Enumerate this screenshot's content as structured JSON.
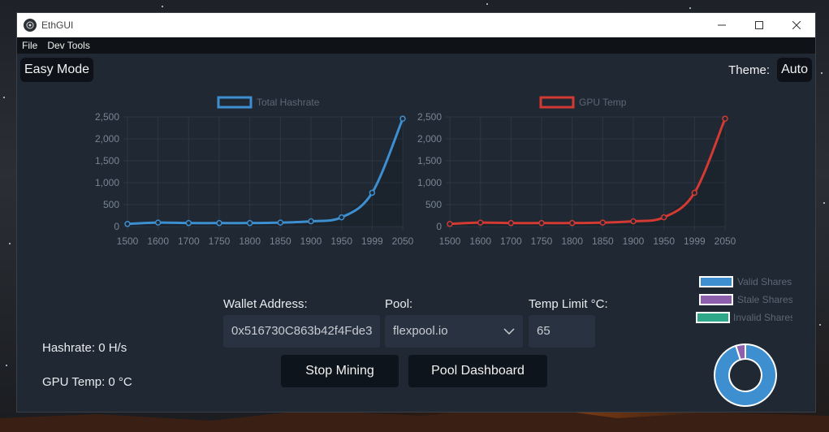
{
  "window": {
    "title": "EthGUI"
  },
  "menu": {
    "items": [
      "File",
      "Dev Tools"
    ]
  },
  "mode_button": "Easy Mode",
  "theme": {
    "label": "Theme:",
    "value": "Auto"
  },
  "form": {
    "wallet_label": "Wallet Address:",
    "wallet_value": "0x516730C863b42f4Fde3",
    "pool_label": "Pool:",
    "pool_value": "flexpool.io",
    "temp_label": "Temp Limit °C:",
    "temp_value": "65"
  },
  "buttons": {
    "stop": "Stop Mining",
    "dashboard": "Pool Dashboard"
  },
  "stats": {
    "hashrate": "Hashrate: 0 H/s",
    "gpu_temp": "GPU Temp: 0 °C"
  },
  "colors": {
    "hashrate": "#3d8fd0",
    "gputemp": "#d23a33",
    "valid": "#3d8fd0",
    "stale": "#8e5fad",
    "invalid": "#2fa88a"
  },
  "chart_data": [
    {
      "type": "line",
      "series": [
        {
          "name": "Total Hashrate",
          "values": [
            60,
            90,
            80,
            80,
            80,
            90,
            120,
            210,
            770,
            2460
          ]
        }
      ],
      "x": [
        "1500",
        "1600",
        "1700",
        "1750",
        "1800",
        "1850",
        "1900",
        "1950",
        "1999",
        "2050"
      ],
      "ylim": [
        0,
        2500
      ],
      "yticks": [
        "0",
        "500",
        "1,000",
        "1,500",
        "2,000",
        "2,500"
      ],
      "legend": "top"
    },
    {
      "type": "line",
      "series": [
        {
          "name": "GPU Temp",
          "values": [
            60,
            90,
            80,
            80,
            80,
            90,
            120,
            210,
            770,
            2460
          ]
        }
      ],
      "x": [
        "1500",
        "1600",
        "1700",
        "1750",
        "1800",
        "1850",
        "1900",
        "1950",
        "1999",
        "2050"
      ],
      "ylim": [
        0,
        2500
      ],
      "yticks": [
        "0",
        "500",
        "1,000",
        "1,500",
        "2,000",
        "2,500"
      ],
      "legend": "top"
    },
    {
      "type": "pie",
      "categories": [
        "Valid Shares",
        "Stale Shares",
        "Invalid Shares"
      ],
      "values": [
        95,
        5,
        0
      ],
      "legend": "top"
    }
  ]
}
